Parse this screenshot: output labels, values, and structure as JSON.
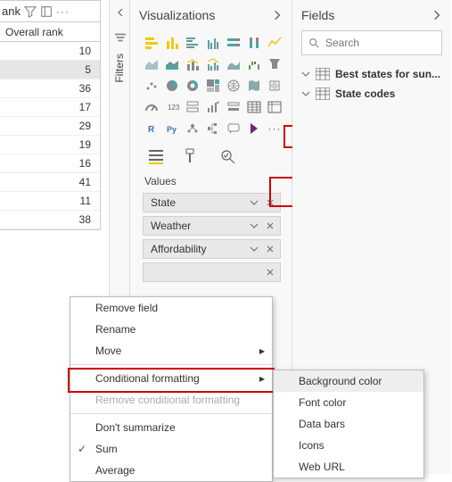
{
  "table_fragment": {
    "header_text": "ank",
    "column_header": "Overall rank",
    "rows": [
      10,
      5,
      36,
      17,
      29,
      19,
      16,
      41,
      11,
      38
    ],
    "selected_index": 1
  },
  "filters_strip": {
    "label": "Filters"
  },
  "visualizations": {
    "title": "Visualizations",
    "tab_labels": {
      "fields": "Fields",
      "format": "Format",
      "analytics": "Analytics"
    },
    "values_label": "Values",
    "wells": [
      {
        "label": "State"
      },
      {
        "label": "Weather"
      },
      {
        "label": "Affordability"
      }
    ]
  },
  "fields_panel": {
    "title": "Fields",
    "search_placeholder": "Search",
    "tables": [
      {
        "name": "Best states for sun..."
      },
      {
        "name": "State codes"
      }
    ]
  },
  "context_menu": {
    "remove_field": "Remove field",
    "rename": "Rename",
    "move": "Move",
    "conditional_formatting": "Conditional formatting",
    "remove_cf": "Remove conditional formatting",
    "dont_summarize": "Don't summarize",
    "sum": "Sum",
    "average": "Average"
  },
  "submenu": {
    "background_color": "Background color",
    "font_color": "Font color",
    "data_bars": "Data bars",
    "icons": "Icons",
    "web_url": "Web URL"
  },
  "icons": {
    "chevron_left": "chevron-left-icon",
    "chevron_right": "chevron-right-icon",
    "chevron_down": "chevron-down-icon"
  }
}
